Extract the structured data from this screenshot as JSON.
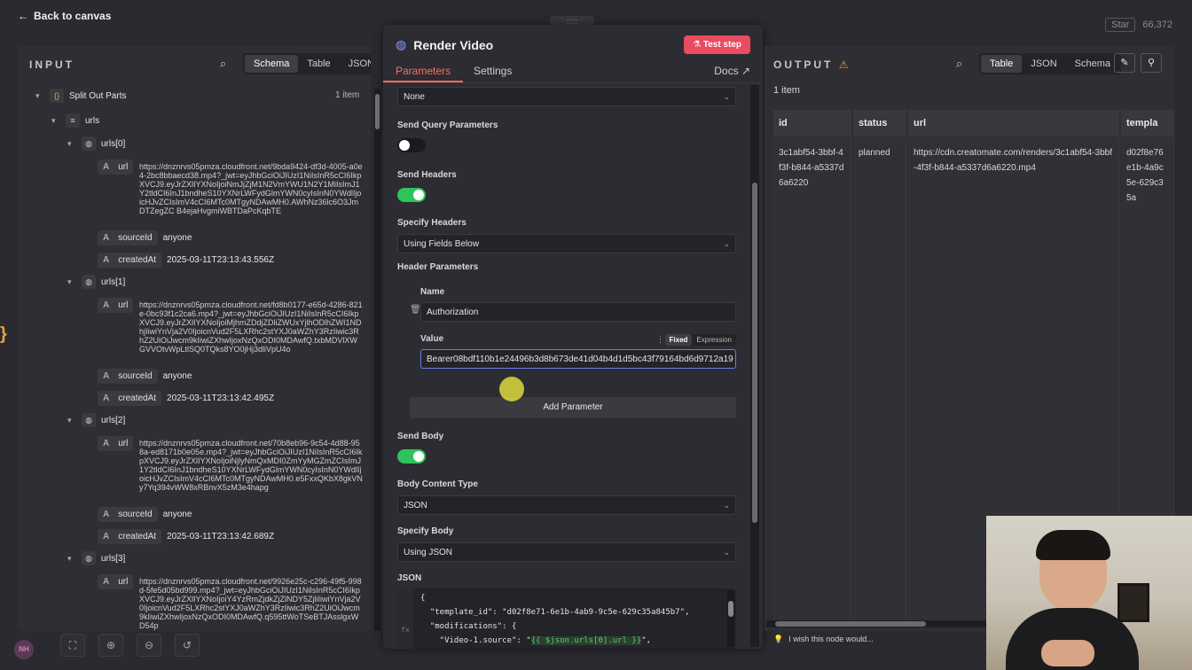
{
  "topbar": {
    "back_label": "Back to canvas",
    "star_label": "Star",
    "star_count": "66,372"
  },
  "input": {
    "title": "INPUT",
    "tabs": [
      "Schema",
      "Table",
      "JSON"
    ],
    "root": {
      "label": "Split Out Parts",
      "count": "1 item"
    },
    "urls_label": "urls",
    "items": [
      {
        "label": "urls[0]",
        "url": "https://dnznrvs05pmza.cloudfront.net/9bda9424-df3d-4005-a0e4-2bc8bbaecd38.mp4?_jwt=eyJhbGciOiJIUzI1NiIsInR5cCI6IkpXVCJ9.eyJrZXlIYXNoIjoiNmJjZjM1N2VmYWU1N2Y1MiIsImJ1Y2tldCI6InJ1bndheS10YXNrLWFydGlmYWN0cyIsInN0YWdlIjoicHJvZCIsImV4cCI6MTc0MTgyNDAwMH0.AWhNz36lc6O3JmDTZegZC B4ejaHvgmiWBTDaPcKqbTE",
        "sourceId": "anyone",
        "createdAt": "2025-03-11T23:13:43.556Z"
      },
      {
        "label": "urls[1]",
        "url": "https://dnznrvs05pmza.cloudfront.net/fd8b0177-e65d-4286-821e-0bc93f1c2ca6.mp4?_jwt=eyJhbGciOiJIUzI1NiIsInR5cCI6IkpXVCJ9.eyJrZXlIYXNoIjoiMjhmZDdjZDliZWUxYjlhODlhZWI1NDhjIiwiYnVja2V0IjoicnVud2F5LXRhc2stYXJ0aWZhY3RzIiwic3RhZ2UiOiJwcm9kIiwiZXhwIjoxNzQxODI0MDAwfQ.txbMDVlXWGVVOtvWpLtlSQ0TQks8YO0jHj3dliVpU4o",
        "sourceId": "anyone",
        "createdAt": "2025-03-11T23:13:42.495Z"
      },
      {
        "label": "urls[2]",
        "url": "https://dnznrvs05pmza.cloudfront.net/70b8eb96-9c54-4d88-958a-ed8171b0e05e.mp4?_jwt=eyJhbGciOiJIUzI1NiIsInR5cCI6IkpXVCJ9.eyJrZXlIYXNoIjoiNjlyNmQxMDI0ZmYyMGZmZCIsImJ1Y2tldCI6InJ1bndheS10YXNrLWFydGlmYWN0cyIsInN0YWdlIjoicHJvZCIsImV4cCI6MTc0MTgyNDAwMH0.e5FxxQKbX8gkVNy7Yq394vWW8xRBnvX5zM3e4hapg",
        "sourceId": "anyone",
        "createdAt": "2025-03-11T23:13:42.689Z"
      },
      {
        "label": "urls[3]",
        "url": "https://dnznrvs05pmza.cloudfront.net/9926e25c-c296-49f5-998d-5fe5d05bd999.mp4?_jwt=eyJhbGciOiJIUzI1NiIsInR5cCI6IkpXVCJ9.eyJrZXlIYXNoIjoiY4YzRmZjdkZjZlNDY5ZjliIiwiYnVja2V0IjoicnVud2F5LXRhc2stYXJ0aWZhY3RzIiwic3RhZ2UiOiJwcm9kIiwiZXhwIjoxNzQxODI0MDAwfQ.q595ttWoTSeBTJAsslgxWD54p"
      }
    ],
    "field_url": "url",
    "field_source": "sourceId",
    "field_created": "createdAt"
  },
  "node": {
    "title": "Render Video",
    "test_label": "Test step",
    "tabs": {
      "parameters": "Parameters",
      "settings": "Settings",
      "docs": "Docs"
    },
    "auth_value": "None",
    "send_query_label": "Send Query Parameters",
    "send_headers_label": "Send Headers",
    "specify_headers_label": "Specify Headers",
    "specify_headers_value": "Using Fields Below",
    "header_params_label": "Header Parameters",
    "name_label": "Name",
    "name_value": "Authorization",
    "value_label": "Value",
    "fixed_label": "Fixed",
    "expression_label": "Expression",
    "value_value": "Bearer08bdf110b1e24496b3d8b673de41d04b4d1d5bc43f79164bd6d9712a19",
    "add_param_label": "Add Parameter",
    "send_body_label": "Send Body",
    "body_type_label": "Body Content Type",
    "body_type_value": "JSON",
    "specify_body_label": "Specify Body",
    "specify_body_value": "Using JSON",
    "json_label": "JSON",
    "code": {
      "l1": "{",
      "l2": "  \"template_id\": \"d02f8e71-6e1b-4ab9-9c5e-629c35a845b7\",",
      "l3": "  \"modifications\": {",
      "l4a": "    \"Video-1.source\": \"",
      "l4b": "{{ $json.urls[0].url }}",
      "l4c": "\","
    }
  },
  "output": {
    "title": "OUTPUT",
    "tabs": [
      "Table",
      "JSON",
      "Schema"
    ],
    "count": "1 item",
    "columns": [
      "id",
      "status",
      "url",
      "templa"
    ],
    "row": [
      "3c1abf54-3bbf-4f3f-b844-a5337d6a6220",
      "planned",
      "https://cdn.creatomate.com/renders/3c1abf54-3bbf-4f3f-b844-a5337d6a6220.mp4",
      "d02f8e76e1b-4a9c5e-629c35a"
    ],
    "wish": "I wish this node would..."
  },
  "bottom": {
    "avatar": "NH"
  }
}
